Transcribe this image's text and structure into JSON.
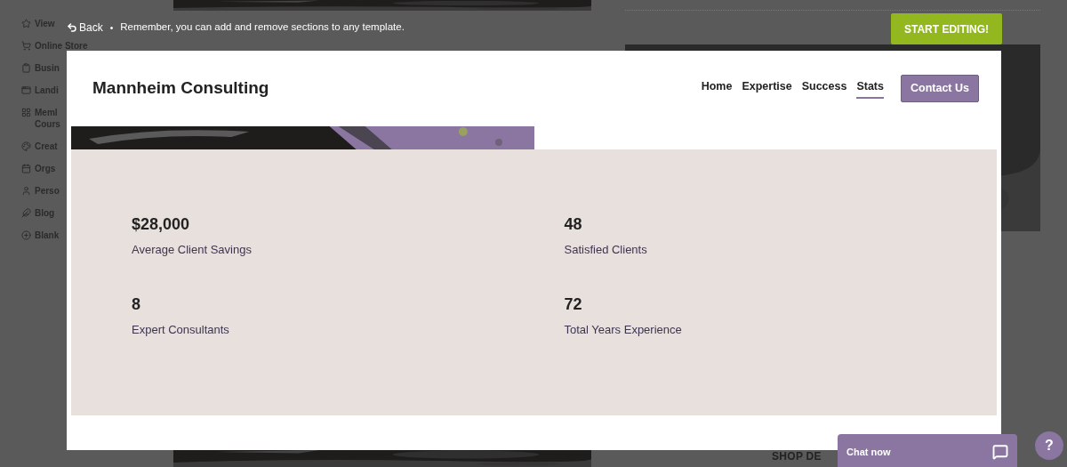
{
  "background": {
    "sidebar": [
      {
        "kind": "star",
        "label": "View"
      },
      {
        "kind": "cart",
        "label": "Online Store"
      },
      {
        "kind": "clipboard",
        "label": "Busin"
      },
      {
        "kind": "window",
        "label": "Landi"
      },
      {
        "kind": "grid",
        "label": "Meml\nCours"
      },
      {
        "kind": "palette",
        "label": "Creat"
      },
      {
        "kind": "calendar",
        "label": "Orgs"
      },
      {
        "kind": "person",
        "label": "Perso"
      },
      {
        "kind": "feather",
        "label": "Blog"
      },
      {
        "kind": "plus",
        "label": "Blank"
      }
    ],
    "footer_heading": "SHOP DE"
  },
  "topbar": {
    "back": "Back",
    "separator": "•",
    "message": "Remember, you can add and remove sections to any template.",
    "action": "START EDITING!"
  },
  "site": {
    "brand": "Mannheim Consulting",
    "nav": [
      {
        "label": "Home",
        "selected": false
      },
      {
        "label": "Expertise",
        "selected": false
      },
      {
        "label": "Success",
        "selected": false
      },
      {
        "label": "Stats",
        "selected": true
      }
    ],
    "cta": "Contact Us"
  },
  "stats": [
    {
      "value": "$28,000",
      "label": "Average Client Savings"
    },
    {
      "value": "48",
      "label": "Satisfied Clients"
    },
    {
      "value": "8",
      "label": "Expert Consultants"
    },
    {
      "value": "72",
      "label": "Total Years Experience"
    }
  ],
  "chat": {
    "label": "Chat now"
  },
  "help": "?"
}
